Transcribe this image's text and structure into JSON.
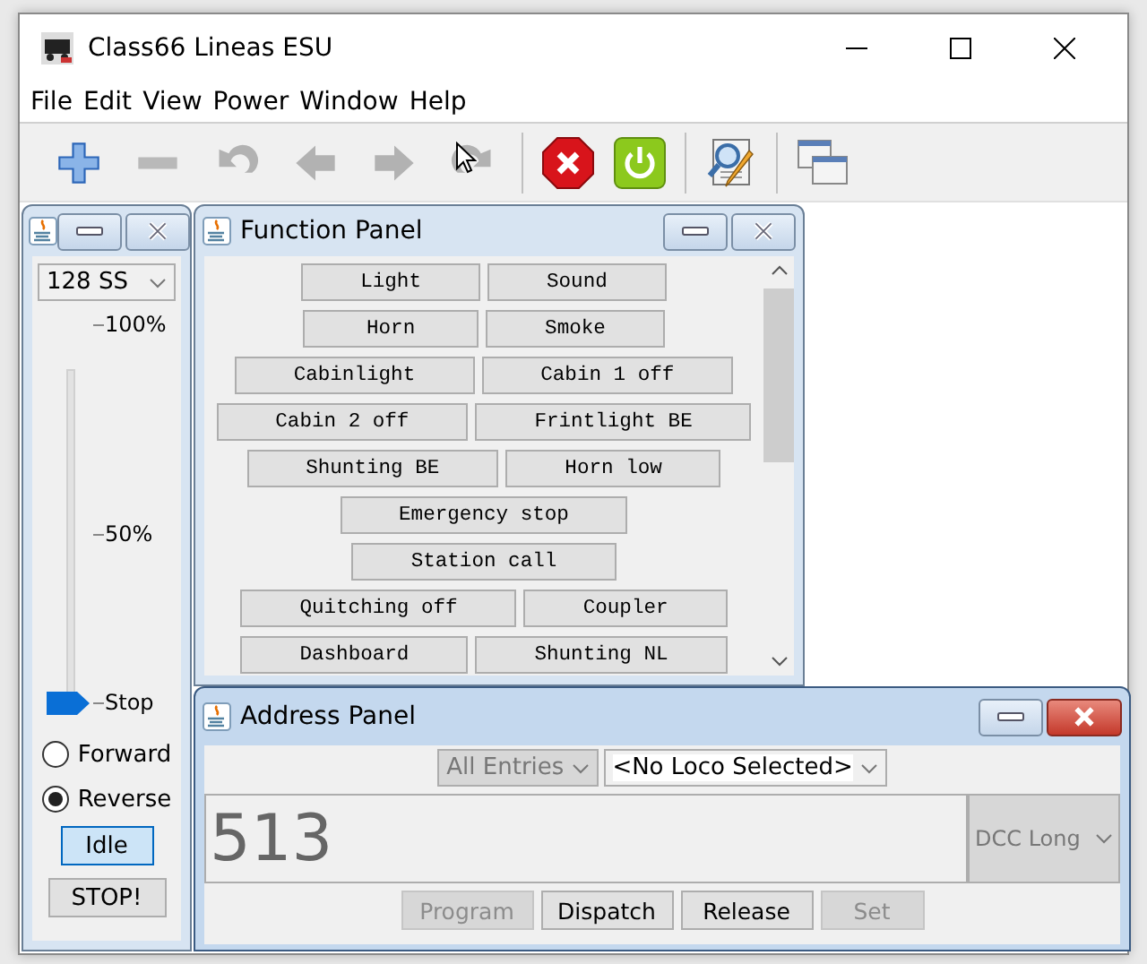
{
  "window": {
    "title": "Class66 Lineas ESU"
  },
  "menu": [
    "File",
    "Edit",
    "View",
    "Power",
    "Window",
    "Help"
  ],
  "toolbar": [
    {
      "kind": "add",
      "disabled": false
    },
    {
      "kind": "remove",
      "disabled": true
    },
    {
      "kind": "undo",
      "disabled": true
    },
    {
      "kind": "back",
      "disabled": true
    },
    {
      "kind": "forward",
      "disabled": true
    },
    {
      "kind": "redo",
      "disabled": true
    },
    {
      "kind": "sep"
    },
    {
      "kind": "stop",
      "disabled": false
    },
    {
      "kind": "power",
      "disabled": false
    },
    {
      "kind": "sep"
    },
    {
      "kind": "inspect",
      "disabled": false
    },
    {
      "kind": "sep"
    },
    {
      "kind": "windows",
      "disabled": false
    }
  ],
  "control_panel": {
    "speed_steps": "128 SS",
    "slider": {
      "ticks": [
        "100%",
        "50%"
      ],
      "thumb_label": "Stop",
      "level": 0
    },
    "directions": [
      {
        "label": "Forward",
        "selected": false
      },
      {
        "label": "Reverse",
        "selected": true
      }
    ],
    "buttons": [
      {
        "label": "Idle",
        "focused": true
      },
      {
        "label": "STOP!",
        "focused": false
      }
    ]
  },
  "function_panel": {
    "title": "Function Panel",
    "rows": [
      [
        "Light",
        "Sound"
      ],
      [
        "Horn",
        "Smoke"
      ],
      [
        "Cabinlight",
        "Cabin 1 off"
      ],
      [
        "Cabin 2 off",
        "Frintlight BE"
      ],
      [
        "Shunting BE",
        "Horn low"
      ],
      [
        "Emergency stop"
      ],
      [
        "Station call"
      ],
      [
        "Quitching off",
        "Coupler"
      ],
      [
        "Dashboard",
        "Shunting NL"
      ]
    ]
  },
  "address_panel": {
    "title": "Address Panel",
    "roster_filter": {
      "value": "All Entries",
      "disabled": true
    },
    "roster": {
      "value": "<No Loco Selected>",
      "disabled": false
    },
    "address": "513",
    "protocol": {
      "value": "DCC Long",
      "disabled": true
    },
    "buttons": [
      {
        "label": "Program",
        "disabled": true
      },
      {
        "label": "Dispatch",
        "disabled": false
      },
      {
        "label": "Release",
        "disabled": false
      },
      {
        "label": "Set",
        "disabled": true
      }
    ]
  }
}
